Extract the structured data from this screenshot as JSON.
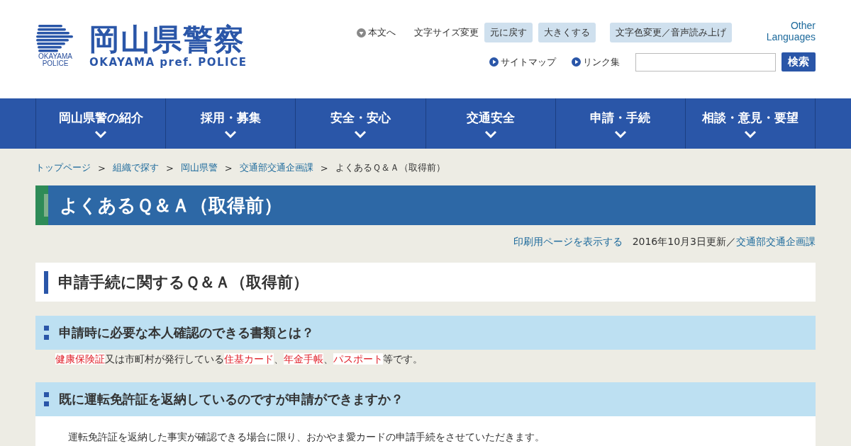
{
  "header": {
    "emblem_text": [
      "OKAYAMA",
      "POLICE"
    ],
    "title": "岡山県警察",
    "subtitle": "OKAYAMA pref. POLICE",
    "skip_link": "本文へ",
    "font_size_label": "文字サイズ変更",
    "font_buttons": [
      "元に戻す",
      "大きくする"
    ],
    "color_button": "文字色変更／音声読み上げ",
    "languages_link": "Other Languages",
    "links": [
      "サイトマップ",
      "リンク集"
    ],
    "search": {
      "button": "検索"
    }
  },
  "nav": [
    "岡山県警の紹介",
    "採用・募集",
    "安全・安心",
    "交通安全",
    "申請・手続",
    "相談・意見・要望"
  ],
  "breadcrumb": {
    "links": [
      "トップページ",
      "組織で探す",
      "岡山県警",
      "交通部交通企画課"
    ],
    "current": "よくあるＱ＆Ａ（取得前）",
    "separator": ">"
  },
  "page_title": "よくあるＱ＆Ａ（取得前）",
  "meta": {
    "print_link": "印刷用ページを表示する",
    "updated": "2016年10月3日更新／",
    "department_link": "交通部交通企画課"
  },
  "section_title": "申請手続に関するＱ＆Ａ（取得前）",
  "questions": [
    {
      "question": "申請時に必要な本人確認のできる書類とは？",
      "answer": [
        {
          "text": "健康保険証",
          "highlight": true
        },
        {
          "text": "又は市町村が発行している",
          "highlight": false
        },
        {
          "text": "住基カード",
          "highlight": true
        },
        {
          "text": "、",
          "highlight": false
        },
        {
          "text": "年金手帳",
          "highlight": true
        },
        {
          "text": "、",
          "highlight": false
        },
        {
          "text": "パスポート",
          "highlight": true
        },
        {
          "text": "等です。",
          "highlight": false
        }
      ],
      "boxed": false
    },
    {
      "question": "既に運転免許証を返納しているのですが申請ができますか？",
      "answer": [
        {
          "text": "運転免許証を返納した事実が確認できる場合に限り、おかやま愛カードの申請手続をさせていただきます。",
          "highlight": false
        }
      ],
      "boxed": true
    }
  ]
}
